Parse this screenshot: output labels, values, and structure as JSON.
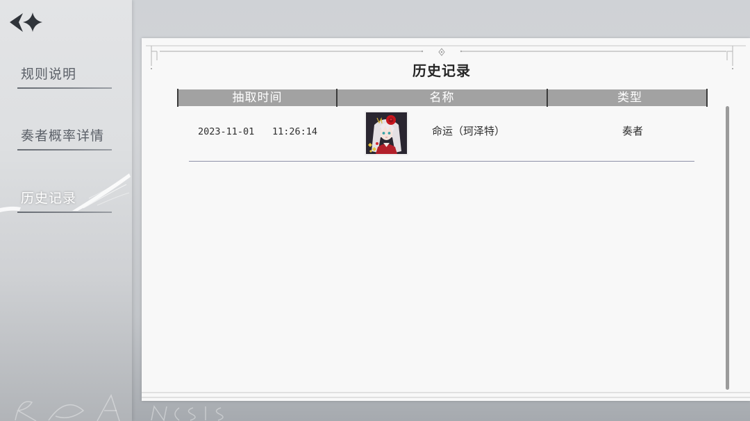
{
  "icons": {
    "back": "back-arrow-icon",
    "ornament": "diamond-ornament-icon"
  },
  "sidebar": {
    "items": [
      {
        "label": "规则说明",
        "selected": false
      },
      {
        "label": "奏者概率详情",
        "selected": false
      },
      {
        "label": "历史记录",
        "selected": true
      }
    ]
  },
  "panel": {
    "title": "历史记录",
    "columns": [
      "抽取时间",
      "名称",
      "类型"
    ],
    "rows": [
      {
        "date": "2023-11-01",
        "time": "11:26:14",
        "portrait": "character-portrait",
        "name": "命运（珂泽特）",
        "type": "奏者"
      }
    ]
  },
  "colors": {
    "panel_bg": "#f8f8f8",
    "header_bg": "#a2a2a2",
    "menu_text": "#5b6068",
    "menu_selected_text": "#ffffff",
    "row_divider": "#8d91a7"
  }
}
